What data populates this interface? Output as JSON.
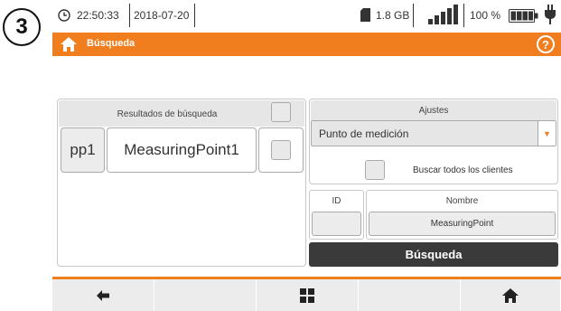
{
  "step_number": "3",
  "status": {
    "time": "22:50:33",
    "date": "2018-07-20",
    "storage": "1.8 GB",
    "battery_percent": "100 %",
    "icons": [
      "clock-icon",
      "sd-card-icon",
      "signal-icon",
      "battery-icon",
      "plug-icon"
    ]
  },
  "header": {
    "title": "Búsqueda",
    "icons": [
      "home-icon",
      "help-icon"
    ]
  },
  "results": {
    "header_label": "Resultados de búsqueda",
    "rows": [
      {
        "id": "pp1",
        "name": "MeasuringPoint1",
        "checked": false
      }
    ]
  },
  "settings": {
    "header_label": "Ajustes",
    "dropdown_value": "Punto de medición",
    "search_all_label": "Buscar todos los clientes",
    "id_header": "ID",
    "name_header": "Nombre",
    "id_value": "",
    "name_value": "MeasuringPoint",
    "search_button": "Búsqueda"
  },
  "nav": {
    "items": [
      "back-icon",
      "",
      "grid-icon",
      "",
      "home-icon"
    ]
  },
  "colors": {
    "accent": "#f07d1e",
    "button_dark": "#3a3a3a",
    "panel_bg": "#e6e6e6"
  }
}
